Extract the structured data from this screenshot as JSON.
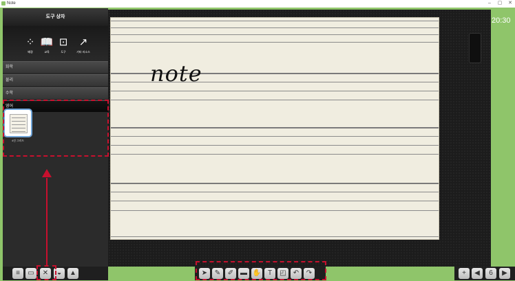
{
  "window": {
    "title": "Note",
    "controls": [
      "–",
      "▢",
      "✕"
    ]
  },
  "panel": {
    "header": "도구 상자",
    "tools": [
      {
        "icon": "magic-wand-icon",
        "glyph": "⁘",
        "label": "배경"
      },
      {
        "icon": "book-icon",
        "glyph": "📖",
        "label": "교육"
      },
      {
        "icon": "toolbox-icon",
        "glyph": "⊡",
        "label": "도구"
      },
      {
        "icon": "external-link-icon",
        "glyph": "↗",
        "label": "기타 리소스"
      }
    ],
    "categories": [
      "화학",
      "물리",
      "수학",
      "영어"
    ],
    "active_category": "영어",
    "resource": {
      "label": "4선 그리드"
    }
  },
  "canvas": {
    "handwriting": "note"
  },
  "status": {
    "time": "20:30"
  },
  "bottom_left": [
    "menu-icon",
    "screen-icon",
    "toolbox-icon",
    "palette-icon",
    "image-icon"
  ],
  "bottom_mid": [
    "pointer-icon",
    "pen-icon",
    "highlighter-icon",
    "eraser-icon",
    "hand-icon",
    "text-icon",
    "shape-icon",
    "undo-icon",
    "redo-icon"
  ],
  "bottom_right": {
    "page_number": "6"
  },
  "colors": {
    "accent": "#8fc56a",
    "highlight": "#c8102e",
    "panel": "#2b2b2b"
  }
}
